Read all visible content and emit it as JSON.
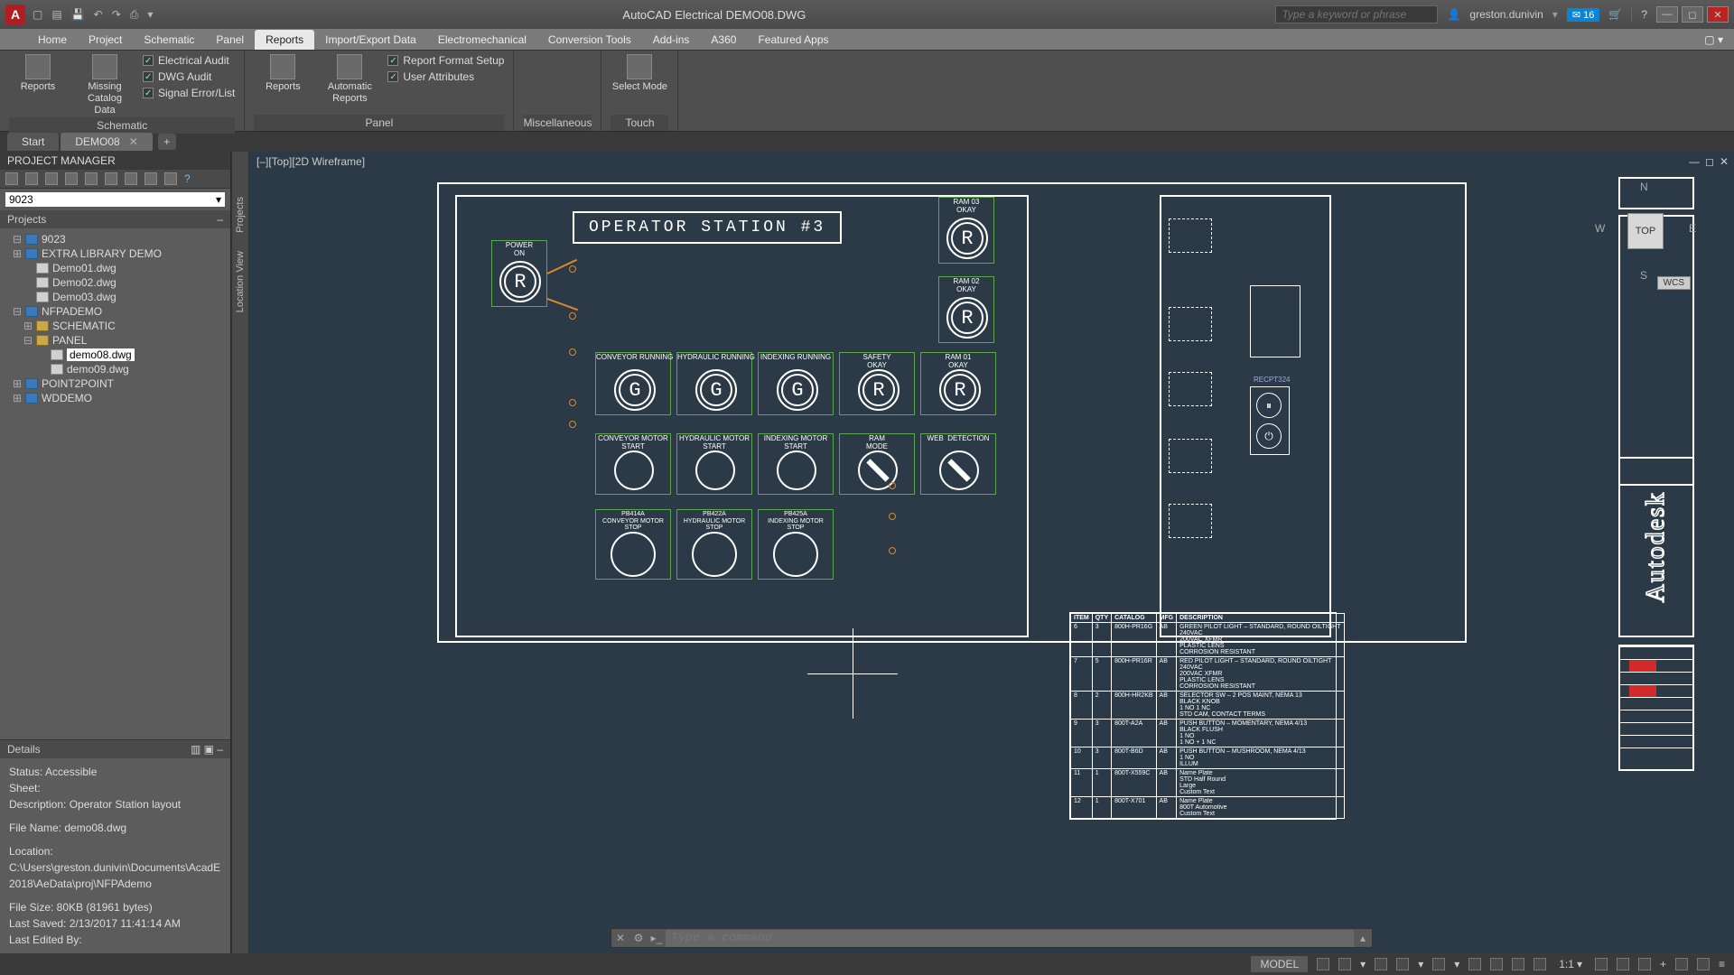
{
  "title": "AutoCAD Electrical   DEMO08.DWG",
  "search_placeholder": "Type a keyword or phrase",
  "user_name": "greston.dunivin",
  "notif_count": "16",
  "menu_tabs": [
    "Home",
    "Project",
    "Schematic",
    "Panel",
    "Reports",
    "Import/Export Data",
    "Electromechanical",
    "Conversion Tools",
    "Add-ins",
    "A360",
    "Featured Apps"
  ],
  "active_tab": "Reports",
  "ribbon": {
    "groups": [
      {
        "label": "Schematic",
        "big": [
          {
            "lbl": "Reports"
          },
          {
            "lbl": "Missing Catalog Data"
          }
        ],
        "small": [
          "Electrical Audit",
          "DWG Audit",
          "Signal Error/List"
        ]
      },
      {
        "label": "Panel",
        "big": [
          {
            "lbl": "Reports"
          },
          {
            "lbl": "Automatic Reports"
          }
        ],
        "small": [
          "Report Format Setup",
          "User Attributes"
        ]
      },
      {
        "label": "Miscellaneous",
        "big": [],
        "small": []
      },
      {
        "label": "Touch",
        "big": [
          {
            "lbl": "Select Mode"
          }
        ],
        "small": []
      }
    ]
  },
  "doc_tabs": [
    "Start",
    "DEMO08"
  ],
  "active_doc": "DEMO08",
  "pm_title": "PROJECT MANAGER",
  "pm_select": "9023",
  "pm_head": "Projects",
  "tree": [
    {
      "lvl": 0,
      "t": "-",
      "icon": "proj",
      "lbl": "9023"
    },
    {
      "lvl": 0,
      "t": "+",
      "icon": "proj",
      "lbl": "EXTRA LIBRARY DEMO"
    },
    {
      "lvl": 1,
      "t": "",
      "icon": "dwg",
      "lbl": "Demo01.dwg"
    },
    {
      "lvl": 1,
      "t": "",
      "icon": "dwg",
      "lbl": "Demo02.dwg"
    },
    {
      "lvl": 1,
      "t": "",
      "icon": "dwg",
      "lbl": "Demo03.dwg"
    },
    {
      "lvl": 0,
      "t": "-",
      "icon": "proj",
      "lbl": "NFPADEMO"
    },
    {
      "lvl": 1,
      "t": "+",
      "icon": "fold",
      "lbl": "SCHEMATIC"
    },
    {
      "lvl": 1,
      "t": "-",
      "icon": "fold",
      "lbl": "PANEL"
    },
    {
      "lvl": 2,
      "t": "",
      "icon": "dwg",
      "lbl": "demo08.dwg",
      "sel": true
    },
    {
      "lvl": 2,
      "t": "",
      "icon": "dwg",
      "lbl": "demo09.dwg"
    },
    {
      "lvl": 0,
      "t": "+",
      "icon": "proj",
      "lbl": "POINT2POINT"
    },
    {
      "lvl": 0,
      "t": "+",
      "icon": "proj",
      "lbl": "WDDEMO"
    }
  ],
  "side_tabs": [
    "Projects",
    "Location View"
  ],
  "details_head": "Details",
  "details": {
    "status": "Status: Accessible",
    "sheet": "Sheet:",
    "desc": "Description: Operator Station layout",
    "fname": "File Name: demo08.dwg",
    "loc": "Location: C:\\Users\\greston.dunivin\\Documents\\AcadE 2018\\AeData\\proj\\NFPAdemo",
    "size": "File Size: 80KB (81961 bytes)",
    "saved": "Last Saved: 2/13/2017 11:41:14 AM",
    "edited": "Last Edited By:"
  },
  "view_label": "[–][Top][2D Wireframe]",
  "drawing": {
    "title": "OPERATOR STATION #3",
    "comps": {
      "power_on": {
        "label": "POWER\nON",
        "ltr": "R"
      },
      "ram02_okay": {
        "label": "RAM 02\nOKAY",
        "ltr": "R"
      },
      "ram03_okay": {
        "label": "RAM 03\nOKAY",
        "ltr": "R"
      },
      "conv_run": {
        "label": "CONVEYOR RUNNING",
        "ltr": "G"
      },
      "hyd_run": {
        "label": "HYDRAULIC RUNNING",
        "ltr": "G"
      },
      "idx_run": {
        "label": "INDEXING RUNNING",
        "ltr": "G"
      },
      "safety": {
        "label": "SAFETY\nOKAY",
        "ltr": "R"
      },
      "ram01_okay": {
        "label": "RAM 01\nOKAY",
        "ltr": "R"
      },
      "conv_start": {
        "label": "CONVEYOR MOTOR\nSTART"
      },
      "hyd_start": {
        "label": "HYDRAULIC MOTOR\nSTART"
      },
      "idx_start": {
        "label": "INDEXING MOTOR\nSTART"
      },
      "ram_mode": {
        "label": "RAM\nMODE"
      },
      "web_det": {
        "label": "WEB  DETECTION"
      },
      "conv_stop": {
        "label": "PB414A\nCONVEYOR MOTOR\nSTOP"
      },
      "hyd_stop": {
        "label": "PB422A\nHYDRAULIC MOTOR\nSTOP"
      },
      "idx_stop": {
        "label": "PB425A\nINDEXING MOTOR\nSTOP"
      }
    },
    "recept_label": "RECPT324"
  },
  "bom_header": [
    "ITEM",
    "QTY",
    "CATALOG",
    "MFG",
    "DESCRIPTION"
  ],
  "bom_rows": [
    [
      "6",
      "3",
      "800H-PR16G",
      "AB",
      "GREEN PILOT LIGHT – STANDARD, ROUND OILTIGHT\n240VAC\n200VAC XFMR\nPLASTIC LENS\nCORROSION RESISTANT"
    ],
    [
      "7",
      "5",
      "800H-PR16R",
      "AB",
      "RED PILOT LIGHT – STANDARD, ROUND OILTIGHT\n240VAC\n200VAC XFMR\nPLASTIC LENS\nCORROSION RESISTANT"
    ],
    [
      "8",
      "2",
      "800H-HR2KB",
      "AB",
      "SELECTOR SW – 2 POS MAINT, NEMA 13\nBLACK KNOB\n1 NO 1 NC\nSTD CAM, CONTACT TERMS"
    ],
    [
      "9",
      "3",
      "800T-A2A",
      "AB",
      "PUSH BUTTON – MOMENTARY, NEMA 4/13\nBLACK FLUSH\n1 NO\n1 NO + 1 NC"
    ],
    [
      "10",
      "3",
      "800T-B6D",
      "AB",
      "PUSH BUTTON – MUSHROOM, NEMA 4/13\n1 NO\nILLUM"
    ],
    [
      "11",
      "1",
      "800T-X559C",
      "AB",
      "Name Plate\nSTD Half Round\nLarge\nCustom Text"
    ],
    [
      "12",
      "1",
      "800T-X701",
      "AB",
      "Name Plate\n800T Automotive\nCustom Text"
    ]
  ],
  "viewcube": {
    "face": "TOP",
    "n": "N",
    "s": "S",
    "e": "E",
    "w": "W",
    "wcs": "WCS"
  },
  "autodesk": "Autodesk",
  "cmd_placeholder": "Type a command",
  "status_model": "MODEL",
  "status_scale": "1:1"
}
